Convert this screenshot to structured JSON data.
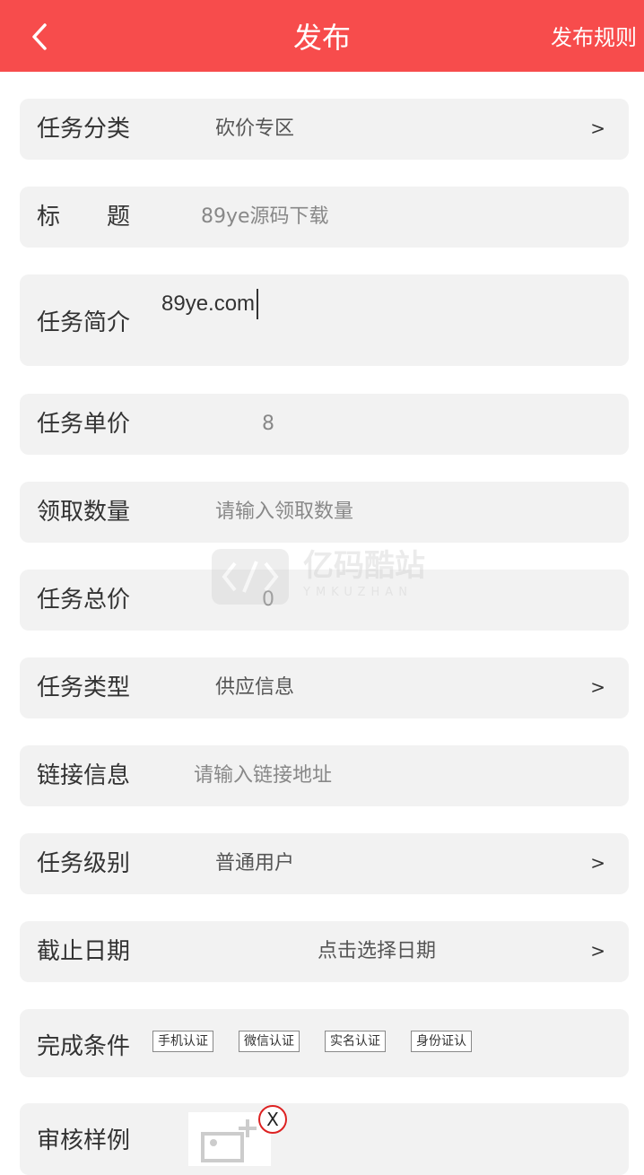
{
  "header": {
    "title": "发布",
    "rules_label": "发布规则"
  },
  "form": {
    "category": {
      "label": "任务分类",
      "value": "砍价专区",
      "chevron": ">"
    },
    "title": {
      "label": "标　　题",
      "value": "89ye源码下载"
    },
    "intro": {
      "label": "任务简介",
      "value": "89ye.com"
    },
    "unit_price": {
      "label": "任务单价",
      "value": "8"
    },
    "quantity": {
      "label": "领取数量",
      "placeholder": "请输入领取数量"
    },
    "total_price": {
      "label": "任务总价",
      "value": "0"
    },
    "task_type": {
      "label": "任务类型",
      "value": "供应信息",
      "chevron": ">"
    },
    "link": {
      "label": "链接信息",
      "placeholder": "请输入链接地址"
    },
    "level": {
      "label": "任务级别",
      "value": "普通用户",
      "chevron": ">"
    },
    "deadline": {
      "label": "截止日期",
      "placeholder": "点击选择日期",
      "chevron": ">"
    },
    "conditions": {
      "label": "完成条件",
      "tags": [
        "手机认证",
        "微信认证",
        "实名认证",
        "身份证认"
      ]
    },
    "sample": {
      "label": "审核样例",
      "delete_glyph": "X"
    }
  },
  "watermark": {
    "text": "亿码酷站",
    "sub": "YMKUZHAN"
  },
  "colors": {
    "header_bg": "#f74c4c",
    "row_bg": "#f2f2f2"
  }
}
